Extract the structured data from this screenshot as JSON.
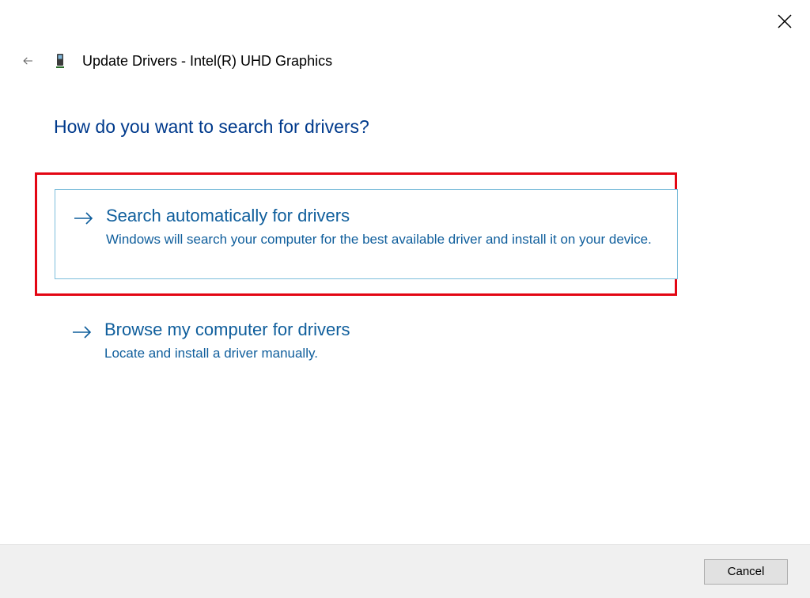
{
  "window": {
    "title": "Update Drivers - Intel(R) UHD Graphics"
  },
  "main": {
    "heading": "How do you want to search for drivers?",
    "options": [
      {
        "title": "Search automatically for drivers",
        "description": "Windows will search your computer for the best available driver and install it on your device."
      },
      {
        "title": "Browse my computer for drivers",
        "description": "Locate and install a driver manually."
      }
    ]
  },
  "footer": {
    "cancel_label": "Cancel"
  }
}
